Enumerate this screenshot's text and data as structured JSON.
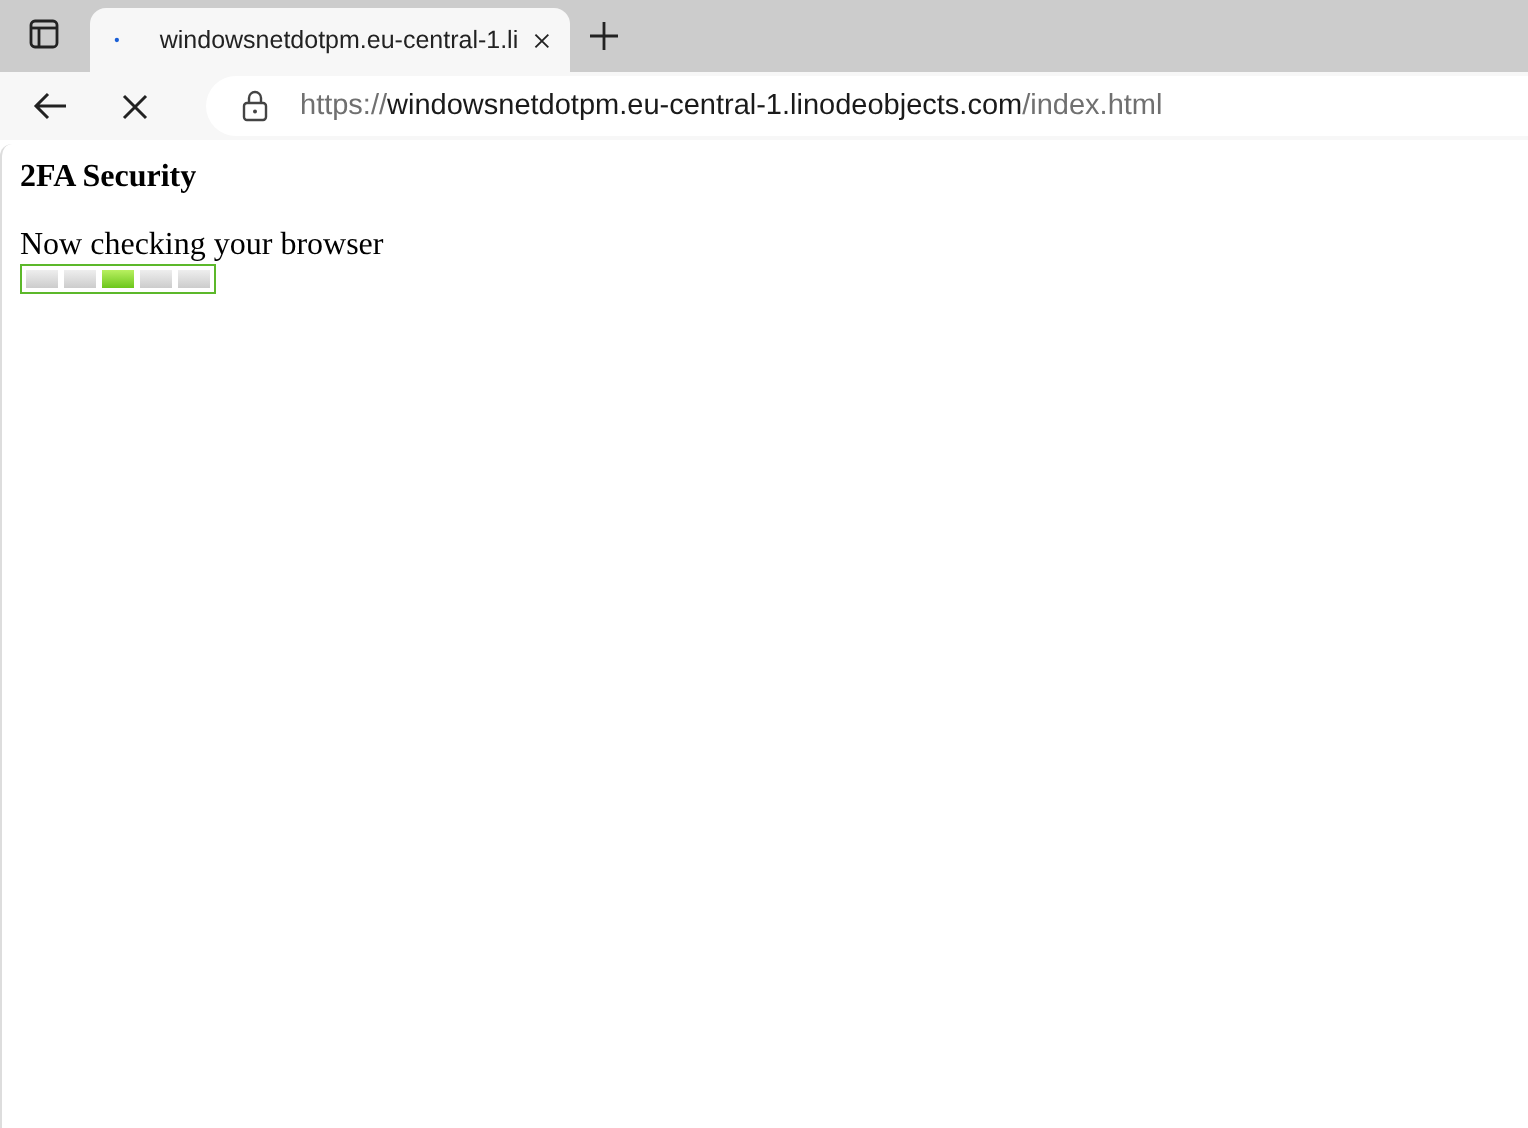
{
  "tab": {
    "title": "windowsnetdotpm.eu-central-1.li",
    "loading": true
  },
  "address_bar": {
    "scheme": "https://",
    "host": "windowsnetdotpm.eu-central-1.linodeobjects.com",
    "path": "/index.html"
  },
  "page": {
    "heading": "2FA Security",
    "message": "Now checking your browser",
    "progress_blocks": [
      {
        "active": false
      },
      {
        "active": false
      },
      {
        "active": true
      },
      {
        "active": false
      },
      {
        "active": false
      }
    ]
  }
}
